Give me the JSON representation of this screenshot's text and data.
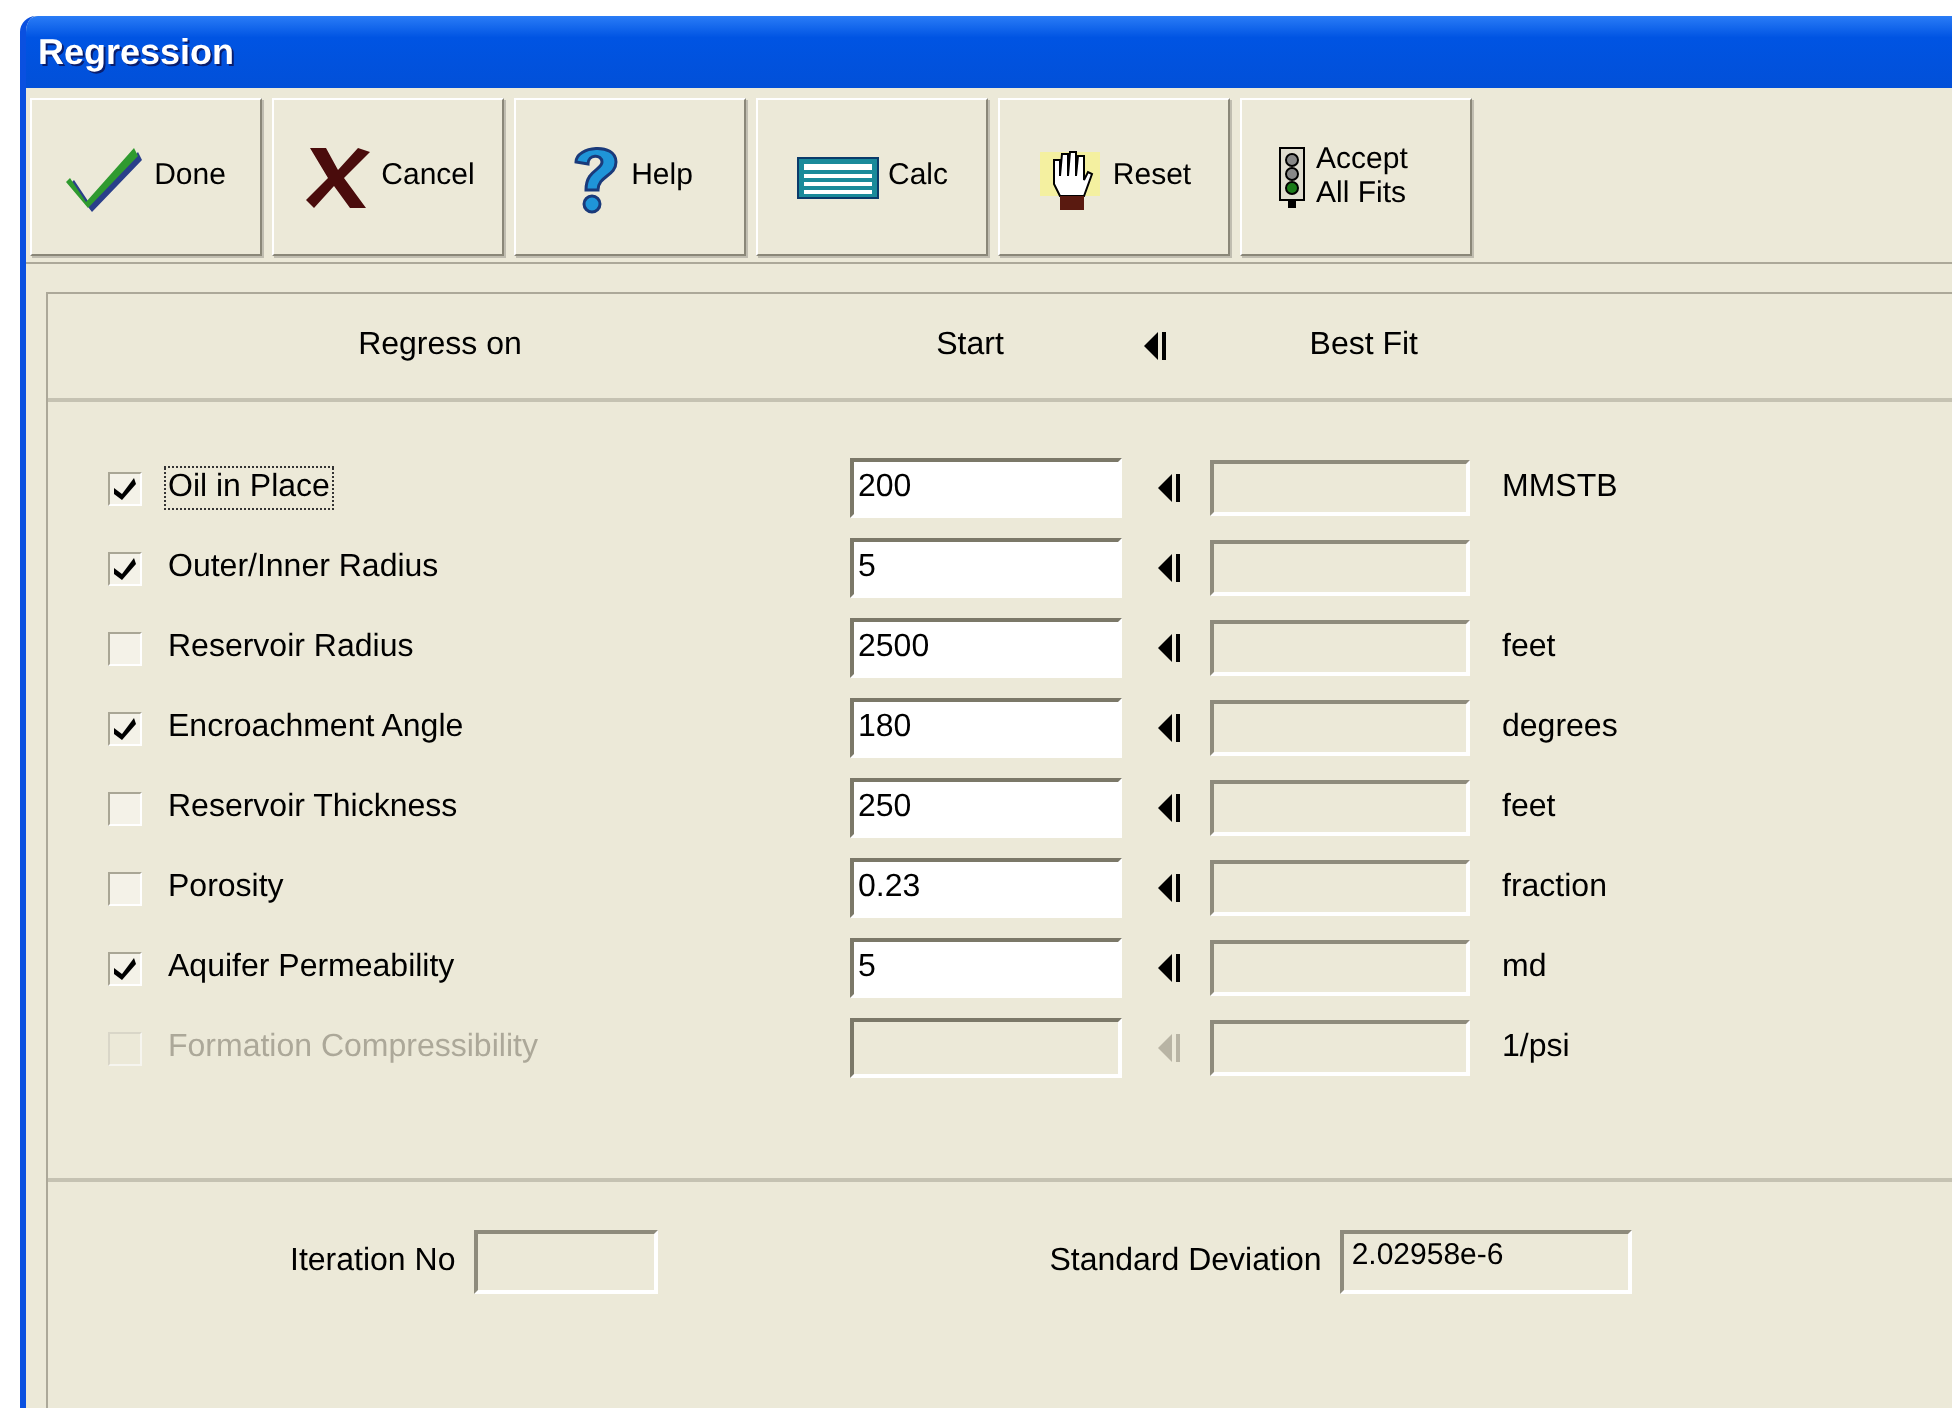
{
  "window": {
    "title": "Regression"
  },
  "toolbar": [
    {
      "label": "Done"
    },
    {
      "label": "Cancel"
    },
    {
      "label": "Help"
    },
    {
      "label": "Calc"
    },
    {
      "label": "Reset"
    },
    {
      "label": "Accept All Fits"
    }
  ],
  "header": {
    "regress_on": "Regress on",
    "start": "Start",
    "best_fit": "Best Fit"
  },
  "parameters": [
    {
      "label": "Oil in Place",
      "checked": true,
      "focused": true,
      "disabled": false,
      "start": "200",
      "unit": "MMSTB"
    },
    {
      "label": "Outer/Inner Radius",
      "checked": true,
      "focused": false,
      "disabled": false,
      "start": "5"
    },
    {
      "label": "Reservoir Radius",
      "checked": false,
      "focused": false,
      "disabled": false,
      "start": "2500",
      "unit": "feet"
    },
    {
      "label": "Encroachment Angle",
      "checked": true,
      "focused": false,
      "disabled": false,
      "start": "180",
      "unit": "degrees"
    },
    {
      "label": "Reservoir Thickness",
      "checked": false,
      "focused": false,
      "disabled": false,
      "start": "250",
      "unit": "feet"
    },
    {
      "label": "Porosity",
      "checked": false,
      "focused": false,
      "disabled": false,
      "start": "0.23",
      "unit": "fraction"
    },
    {
      "label": "Aquifer Permeability",
      "checked": true,
      "focused": false,
      "disabled": false,
      "start": "5",
      "unit": "md"
    },
    {
      "label": "Formation Compressibility",
      "checked": false,
      "focused": false,
      "disabled": true,
      "unit": "1/psi"
    }
  ],
  "footer": {
    "iteration_label": "Iteration No",
    "std_dev_label": "Standard Deviation",
    "std_dev_value": "2.02958e-6"
  }
}
